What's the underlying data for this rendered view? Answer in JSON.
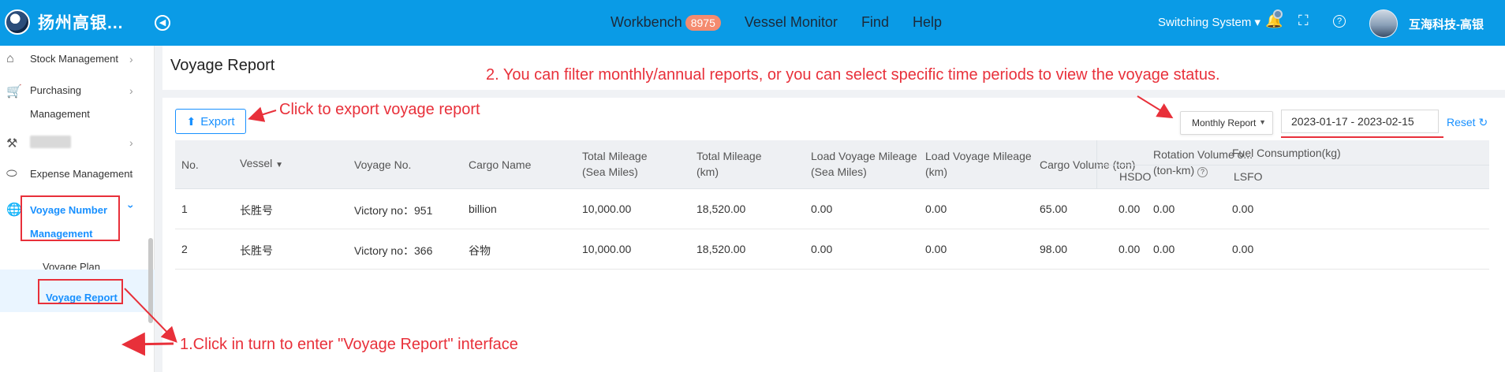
{
  "header": {
    "brand_name": "扬州高银...",
    "nav": [
      {
        "label": "Workbench",
        "badge": "8975"
      },
      {
        "label": "Vessel Monitor"
      },
      {
        "label": "Find"
      },
      {
        "label": "Help"
      }
    ],
    "switching_system": "Switching System ▾",
    "username": "互海科技-高银"
  },
  "sidebar": {
    "items": [
      {
        "label": "Stock Management",
        "icon": "home-icon"
      },
      {
        "label": "Purchasing",
        "label2": "Management",
        "icon": "cart-icon"
      },
      {
        "label": "",
        "icon": "hammer-icon"
      },
      {
        "label": "Expense Management",
        "icon": "database-icon"
      },
      {
        "label": "Voyage Number",
        "label2": "Management",
        "icon": "globe-icon"
      }
    ],
    "sub_items": [
      {
        "label": "Voyage Plan"
      },
      {
        "label": "Voyage Report"
      }
    ]
  },
  "page": {
    "title": "Voyage Report",
    "export_label": "Export",
    "period_select": "Monthly Report",
    "date_range": "2023-01-17 - 2023-02-15",
    "reset_label": "Reset"
  },
  "table": {
    "headers": {
      "no": "No.",
      "vessel": "Vessel",
      "voyage_no": "Voyage No.",
      "cargo_name": "Cargo Name",
      "total_mileage_sea_1": "Total Mileage",
      "total_mileage_sea_2": "(Sea Miles)",
      "total_mileage_km_1": "Total Mileage",
      "total_mileage_km_2": "(km)",
      "load_sea_1": "Load Voyage Mileage",
      "load_sea_2": "(Sea Miles)",
      "load_km_1": "Load Voyage Mileage",
      "load_km_2": "(km)",
      "cargo_volume": "Cargo Volume (ton)",
      "rotation_1": "Rotation Volume o...",
      "rotation_2": "(ton-km)",
      "fuel": "Fuel Consumption(kg)",
      "hsdo": "HSDO",
      "lsfo": "LSFO"
    },
    "rows": [
      {
        "no": "1",
        "vessel": "长胜号",
        "voyage_no": "Victory no：951",
        "cargo_name": "billion",
        "total_sea": "10,000.00",
        "total_km": "18,520.00",
        "load_sea": "0.00",
        "load_km": "0.00",
        "cargo_volume": "65.00",
        "rotation": "0.00",
        "hsdo": "0.00",
        "lsfo": "0.00"
      },
      {
        "no": "2",
        "vessel": "长胜号",
        "voyage_no": "Victory no：366",
        "cargo_name": "谷物",
        "total_sea": "10,000.00",
        "total_km": "18,520.00",
        "load_sea": "0.00",
        "load_km": "0.00",
        "cargo_volume": "98.00",
        "rotation": "0.00",
        "hsdo": "0.00",
        "lsfo": "0.00"
      }
    ]
  },
  "annotations": {
    "step1": "1.Click in turn to enter \"Voyage Report\" interface",
    "step2": "2. You can filter monthly/annual reports, or you can select specific time periods to view the voyage status.",
    "export_hint": "Click to export voyage report"
  },
  "colors": {
    "topbar": "#0a9be6",
    "accent": "#1890ff",
    "annotation_red": "#e8303a",
    "badge": "#f48b6f"
  }
}
